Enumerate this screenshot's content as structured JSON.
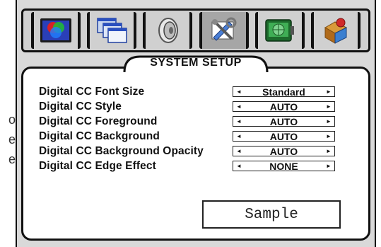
{
  "edge_fragments": [
    "o",
    "e",
    "e"
  ],
  "tabs": [
    {
      "icon": "color-picture-icon",
      "active": false
    },
    {
      "icon": "windows-pip-icon",
      "active": false
    },
    {
      "icon": "speaker-audio-icon",
      "active": false
    },
    {
      "icon": "tools-setup-icon",
      "active": true
    },
    {
      "icon": "globe-channel-icon",
      "active": false
    },
    {
      "icon": "parental-lock-icon",
      "active": false
    }
  ],
  "panel": {
    "title": "SYSTEM SETUP"
  },
  "settings": [
    {
      "label": "Digital CC Font Size",
      "value": "Standard"
    },
    {
      "label": "Digital CC Style",
      "value": "AUTO"
    },
    {
      "label": "Digital CC Foreground",
      "value": "AUTO"
    },
    {
      "label": "Digital CC Background",
      "value": "AUTO"
    },
    {
      "label": "Digital CC Background Opacity",
      "value": "AUTO"
    },
    {
      "label": "Digital CC Edge Effect",
      "value": "NONE"
    }
  ],
  "arrows": {
    "left": "◄",
    "right": "►"
  },
  "sample_text": "Sample",
  "colors": {
    "osd_background": "#d9d9d9",
    "active_tab": "#a6a6a6",
    "panel_background": "#ffffff",
    "border": "#111111"
  }
}
